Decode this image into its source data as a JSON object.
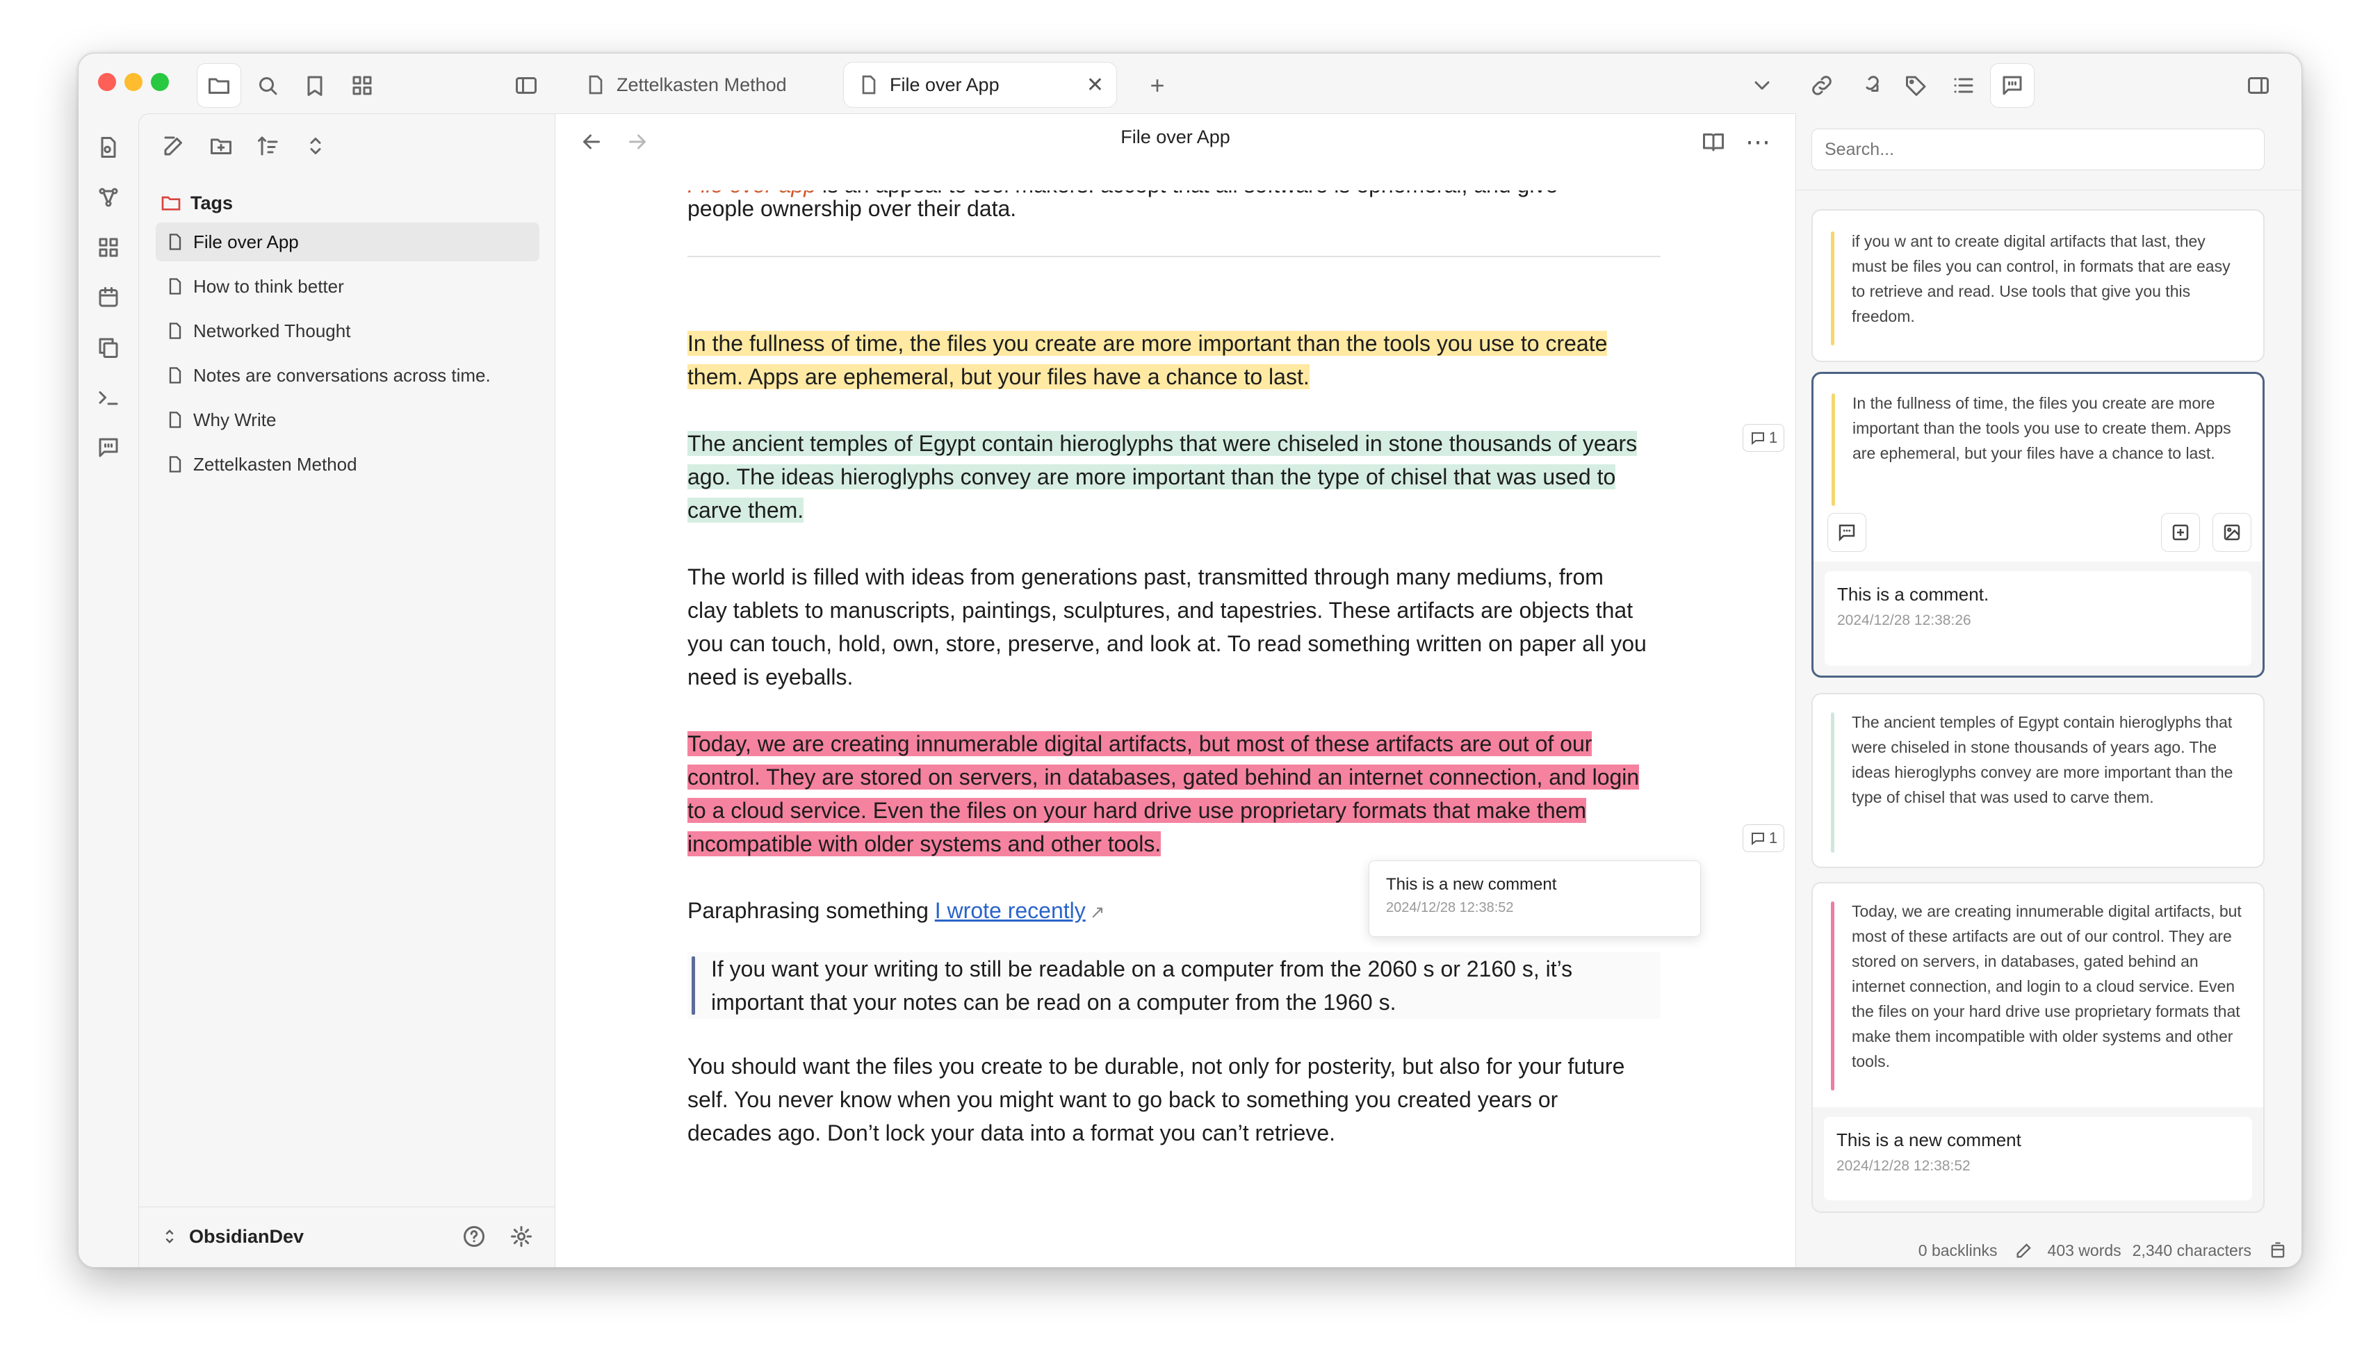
{
  "tabs": [
    {
      "label": "Zettelkasten Method",
      "active": false
    },
    {
      "label": "File over App",
      "active": true
    }
  ],
  "sidebar": {
    "folder": "Tags",
    "files": [
      "File over App",
      "How to think better",
      "Networked Thought",
      "Notes are conversations across time.",
      "Why Write",
      "Zettelkasten Method"
    ],
    "vault": "ObsidianDev"
  },
  "editor": {
    "title": "File over App",
    "intro_top_lead": "File over app",
    "intro_top_rest": " is an appeal to tool makers: accept that all software is ephemeral, and give",
    "intro_bottom": "people ownership over their data.",
    "p1": "In the fullness of time, the files you create are more important than the tools you use to create them. Apps are ephemeral, but your files have a chance to last.",
    "p2": "The ancient temples of Egypt contain hieroglyphs that were chiseled in stone thousands of years ago. The ideas hieroglyphs convey are more important than the type of chisel that was used to carve them.",
    "p3": "The world is filled with ideas from generations past, transmitted through many mediums, from clay tablets to manuscripts, paintings, sculptures, and tapestries. These artifacts are objects that you can touch, hold, own, store, preserve, and look at. To read something written on paper all you need is eyeballs.",
    "p4": "Today, we are creating innumerable digital artifacts, but most of these artifacts are out of our control. They are stored on servers, in databases, gated behind an internet connection, and login to a cloud service. Even the files on your hard drive use proprietary formats that make them incompatible with older systems and other tools.",
    "p5_prefix": "Paraphrasing something ",
    "p5_link": "I wrote recently",
    "quote": "If you want your writing to still be readable on a computer from the 2060 s or 2160 s, it’s important that your notes can be read on a computer from the 1960 s.",
    "p6": "You should want the files you create to be durable, not only for posterity, but also for your future self. You never know when you might want to go back to something you created years or decades ago. Don’t lock your data into a format you can’t retrieve.",
    "badge1": "1",
    "badge2": "1",
    "popup_text": "This is a new comment",
    "popup_date": "2024/12/28 12:38:52"
  },
  "right_panel": {
    "search_placeholder": "Search...",
    "cards": [
      {
        "text": "if you w ant to create digital artifacts that last, they must be files you can control, in formats that are easy to retrieve and read. Use tools that give you this freedom.",
        "color": "#f5d76e"
      },
      {
        "text": "In the fullness of time, the files you create are more important than the tools you use to create them. Apps are ephemeral, but your files have a chance to last.",
        "color": "#f5d76e",
        "comment": "This is  a comment.",
        "date": "2024/12/28 12:38:26"
      },
      {
        "text": "The ancient temples of Egypt contain hieroglyphs that were chiseled in stone thousands of years ago. The ideas hieroglyphs convey are more important than the type of chisel that was used to carve them.",
        "color": "#cfe7da"
      },
      {
        "text": "Today, we are creating innumerable digital artifacts, but most of these artifacts are out of our control. They are stored on servers, in databases, gated behind an internet connection, and login to a cloud service. Even the files on your hard drive use proprietary formats that make them incompatible with older systems and other tools.",
        "color": "#ec7fa0",
        "comment": "This is a new comment",
        "date": "2024/12/28 12:38:52"
      }
    ]
  },
  "status": {
    "backlinks": "0 backlinks",
    "words": "403 words",
    "chars": "2,340 characters"
  },
  "colors": {
    "yellow": "#ffe9a3",
    "green": "#d6eee2",
    "red": "#f5829f",
    "accent": "#d3572a",
    "link": "#2a64c9"
  }
}
